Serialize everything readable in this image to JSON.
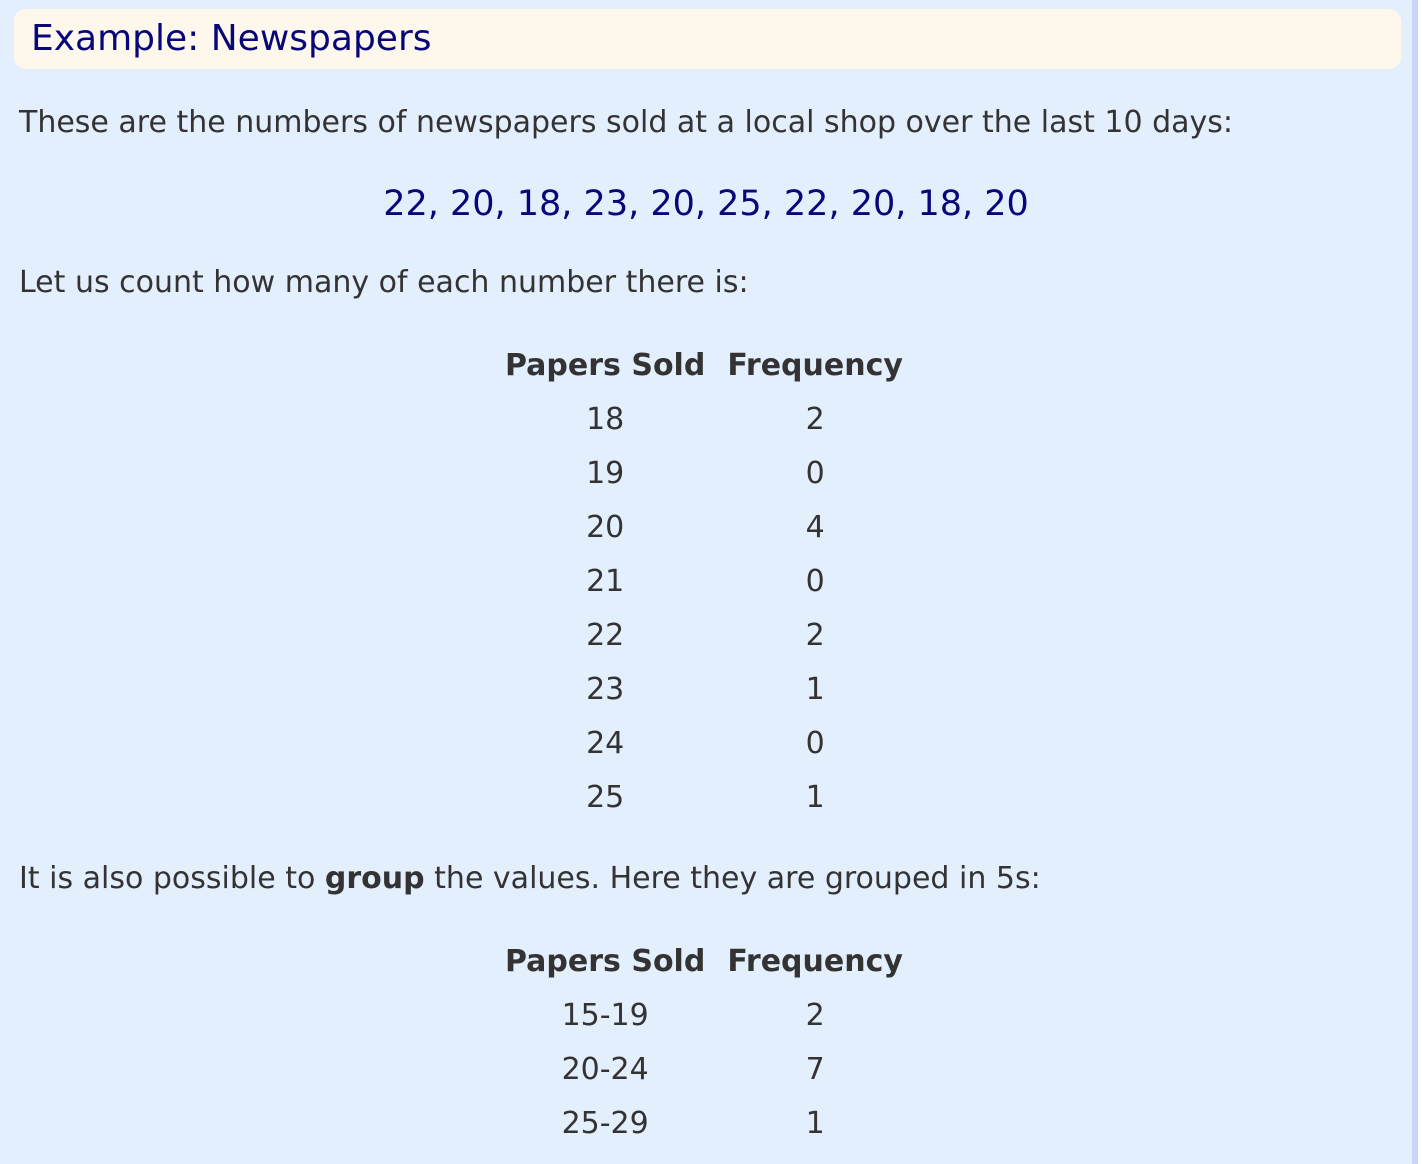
{
  "example": {
    "title": "Example: Newspapers",
    "intro": "These are the numbers of newspapers sold at a local shop over the last 10 days:",
    "sequence": "22, 20, 18, 23, 20, 25, 22, 20, 18, 20",
    "count_intro": "Let us count how many of each number there is:",
    "table1": {
      "headers": [
        "Papers Sold",
        "Frequency"
      ],
      "rows": [
        [
          "18",
          "2"
        ],
        [
          "19",
          "0"
        ],
        [
          "20",
          "4"
        ],
        [
          "21",
          "0"
        ],
        [
          "22",
          "2"
        ],
        [
          "23",
          "1"
        ],
        [
          "24",
          "0"
        ],
        [
          "25",
          "1"
        ]
      ]
    },
    "group_intro": {
      "before": "It is also possible to ",
      "bold": "group",
      "after": " the values. Here they are grouped in 5s:"
    },
    "table2": {
      "headers": [
        "Papers Sold",
        "Frequency"
      ],
      "rows": [
        [
          "15-19",
          "2"
        ],
        [
          "20-24",
          "7"
        ],
        [
          "25-29",
          "1"
        ]
      ]
    }
  }
}
